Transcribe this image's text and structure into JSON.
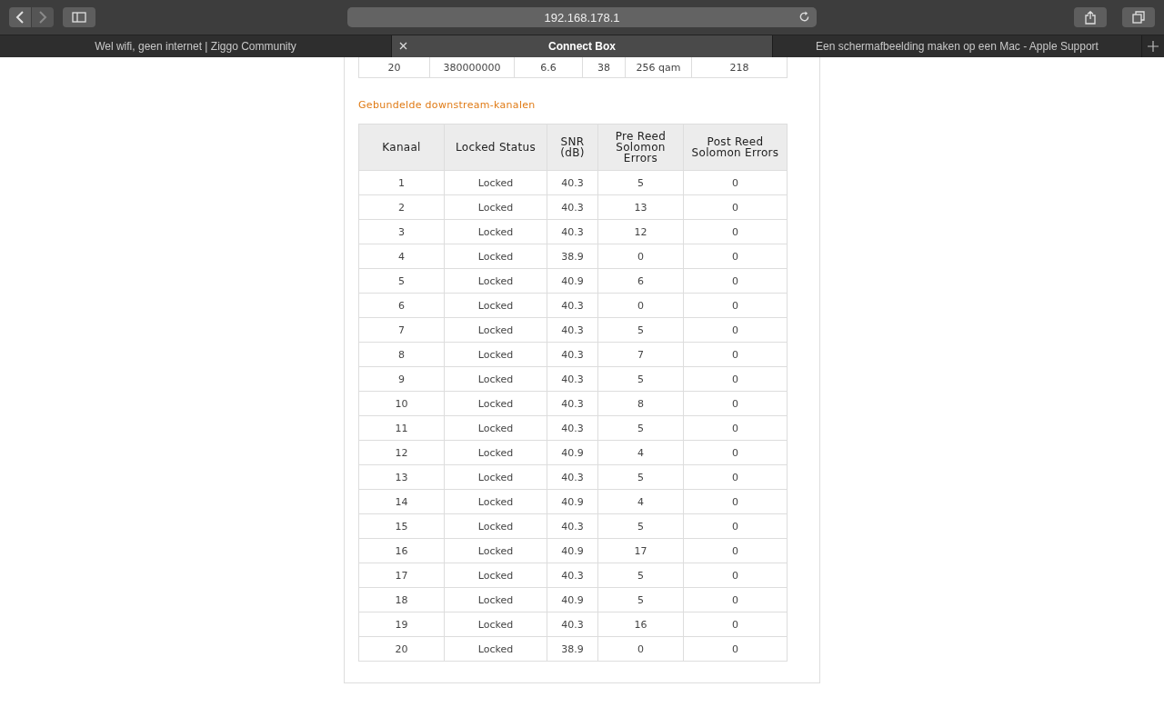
{
  "toolbar": {
    "address": "192.168.178.1"
  },
  "tabs": [
    {
      "label": "Wel wifi, geen internet | Ziggo Community",
      "selected": false
    },
    {
      "label": "Connect Box",
      "selected": true
    },
    {
      "label": "Een schermafbeelding maken op een Mac - Apple Support",
      "selected": false
    }
  ],
  "upstream_table": {
    "rows": [
      [
        "20",
        "380000000",
        "6.6",
        "38",
        "256 qam",
        "218"
      ]
    ]
  },
  "section_title": "Gebundelde downstream-kanalen",
  "table": {
    "columns": [
      "Kanaal",
      "Locked Status",
      "SNR (dB)",
      "Pre Reed Solomon Errors",
      "Post Reed Solomon Errors"
    ],
    "rows": [
      [
        "1",
        "Locked",
        "40.3",
        "5",
        "0"
      ],
      [
        "2",
        "Locked",
        "40.3",
        "13",
        "0"
      ],
      [
        "3",
        "Locked",
        "40.3",
        "12",
        "0"
      ],
      [
        "4",
        "Locked",
        "38.9",
        "0",
        "0"
      ],
      [
        "5",
        "Locked",
        "40.9",
        "6",
        "0"
      ],
      [
        "6",
        "Locked",
        "40.3",
        "0",
        "0"
      ],
      [
        "7",
        "Locked",
        "40.3",
        "5",
        "0"
      ],
      [
        "8",
        "Locked",
        "40.3",
        "7",
        "0"
      ],
      [
        "9",
        "Locked",
        "40.3",
        "5",
        "0"
      ],
      [
        "10",
        "Locked",
        "40.3",
        "8",
        "0"
      ],
      [
        "11",
        "Locked",
        "40.3",
        "5",
        "0"
      ],
      [
        "12",
        "Locked",
        "40.9",
        "4",
        "0"
      ],
      [
        "13",
        "Locked",
        "40.3",
        "5",
        "0"
      ],
      [
        "14",
        "Locked",
        "40.9",
        "4",
        "0"
      ],
      [
        "15",
        "Locked",
        "40.3",
        "5",
        "0"
      ],
      [
        "16",
        "Locked",
        "40.9",
        "17",
        "0"
      ],
      [
        "17",
        "Locked",
        "40.3",
        "5",
        "0"
      ],
      [
        "18",
        "Locked",
        "40.9",
        "5",
        "0"
      ],
      [
        "19",
        "Locked",
        "40.3",
        "16",
        "0"
      ],
      [
        "20",
        "Locked",
        "38.9",
        "0",
        "0"
      ]
    ]
  }
}
